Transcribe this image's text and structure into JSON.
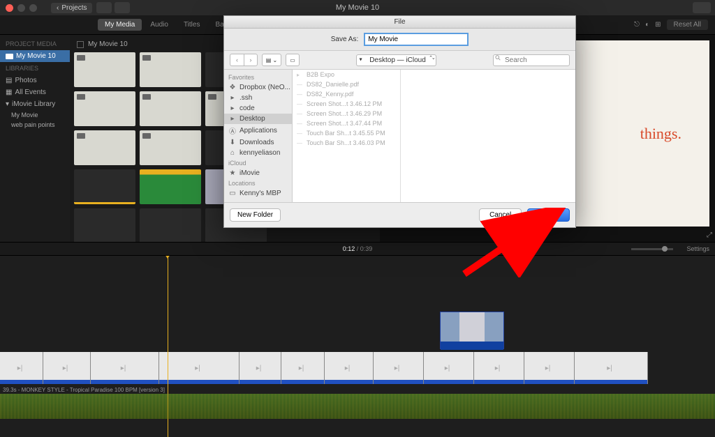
{
  "titlebar": {
    "title": "My Movie 10",
    "projects_label": "Projects"
  },
  "tabs": [
    {
      "label": "My Media",
      "active": true
    },
    {
      "label": "Audio",
      "active": false
    },
    {
      "label": "Titles",
      "active": false
    },
    {
      "label": "Backgrounds",
      "active": false
    }
  ],
  "reset_label": "Reset All",
  "sidebar": {
    "project_media_header": "PROJECT MEDIA",
    "project_item": "My Movie 10",
    "libraries_header": "LIBRARIES",
    "photos": "Photos",
    "all_events": "All Events",
    "imovie_library": "iMovie Library",
    "lib_items": [
      "My Movie",
      "web pain points"
    ]
  },
  "browser_title": "My Movie 10",
  "preview_text": "things.",
  "timeline": {
    "current": "0:12",
    "total": "0:39",
    "settings": "Settings",
    "audio_label": "39.3s - MONKEY STYLE - Tropical Paradise 100 BPM [version 3]"
  },
  "dialog": {
    "title": "File",
    "save_as_label": "Save As:",
    "filename": "My Movie",
    "location": "Desktop — iCloud",
    "search_placeholder": "Search",
    "sidebar": {
      "favorites": "Favorites",
      "items_fav": [
        {
          "icon": "dropbox",
          "label": "Dropbox (NeO..."
        },
        {
          "icon": "folder",
          "label": ".ssh"
        },
        {
          "icon": "folder",
          "label": "code"
        },
        {
          "icon": "folder",
          "label": "Desktop",
          "active": true
        },
        {
          "icon": "app",
          "label": "Applications"
        },
        {
          "icon": "download",
          "label": "Downloads"
        },
        {
          "icon": "home",
          "label": "kennyeliason"
        }
      ],
      "icloud": "iCloud",
      "items_icloud": [
        {
          "icon": "star",
          "label": "iMovie"
        }
      ],
      "locations": "Locations",
      "items_loc": [
        {
          "icon": "laptop",
          "label": "Kenny's MBP"
        }
      ]
    },
    "files": [
      {
        "name": "B2B Expo",
        "type": "folder"
      },
      {
        "name": "DS82_Danielle.pdf",
        "type": "file"
      },
      {
        "name": "DS82_Kenny.pdf",
        "type": "file"
      },
      {
        "name": "Screen Shot...t 3.46.12 PM",
        "type": "file"
      },
      {
        "name": "Screen Shot...t 3.46.29 PM",
        "type": "file"
      },
      {
        "name": "Screen Shot...t 3.47.44 PM",
        "type": "file"
      },
      {
        "name": "Touch Bar Sh...t 3.45.55 PM",
        "type": "file"
      },
      {
        "name": "Touch Bar Sh...t 3.46.03 PM",
        "type": "file"
      }
    ],
    "new_folder": "New Folder",
    "cancel": "Cancel",
    "save": "Save"
  }
}
